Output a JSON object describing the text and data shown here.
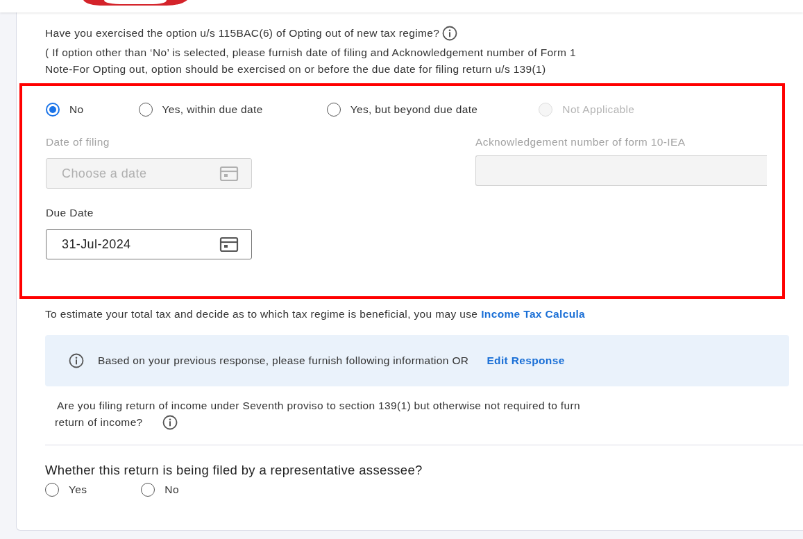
{
  "opt_out": {
    "question": "Have you exercised the option u/s 115BAC(6) of Opting out of new tax regime?",
    "note_lines": [
      "( If option other than ‘No’ is selected, please furnish date of filing and Acknowledgement  number of Form 1",
      "Note-For Opting out, option should be exercised on or before the due date for filing return u/s 139(1)"
    ],
    "options": [
      {
        "label": "No",
        "selected": true,
        "disabled": false
      },
      {
        "label": "Yes, within due date",
        "selected": false,
        "disabled": false
      },
      {
        "label": "Yes, but beyond due date",
        "selected": false,
        "disabled": false
      },
      {
        "label": "Not Applicable",
        "selected": false,
        "disabled": true
      }
    ],
    "date_of_filing": {
      "label": "Date of filing",
      "placeholder": "Choose a date",
      "disabled": true
    },
    "ack_number": {
      "label": "Acknowledgement number of form 10-IEA",
      "disabled": true
    },
    "due_date": {
      "label": "Due Date",
      "value": "31-Jul-2024",
      "disabled": false
    }
  },
  "estimate": {
    "text": "To estimate your total tax and decide as to which tax regime is beneficial, you may use",
    "link": "Income Tax Calcula"
  },
  "info_banner": {
    "text": "Based on your previous response, please furnish following information OR",
    "link": "Edit Response"
  },
  "seventh_proviso": {
    "lines": [
      "Are you filing return of income under Seventh proviso to section 139(1) but otherwise not required to furn",
      "return of income?"
    ]
  },
  "representative": {
    "question": "Whether this return is being filed by a representative assessee?",
    "options": [
      {
        "label": "Yes",
        "selected": false,
        "disabled": false
      },
      {
        "label": "No",
        "selected": false,
        "disabled": false
      }
    ]
  }
}
